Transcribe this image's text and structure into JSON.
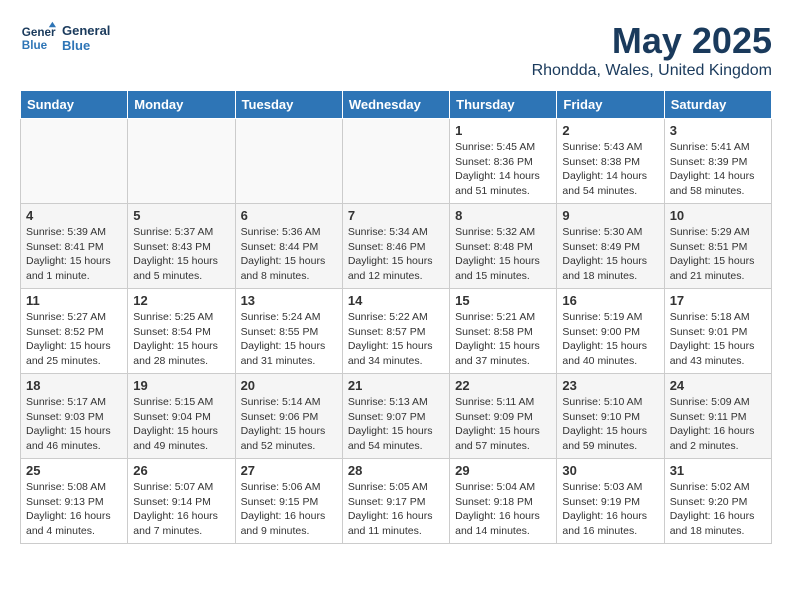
{
  "logo": {
    "line1": "General",
    "line2": "Blue"
  },
  "title": "May 2025",
  "location": "Rhondda, Wales, United Kingdom",
  "weekdays": [
    "Sunday",
    "Monday",
    "Tuesday",
    "Wednesday",
    "Thursday",
    "Friday",
    "Saturday"
  ],
  "weeks": [
    [
      {
        "day": "",
        "info": ""
      },
      {
        "day": "",
        "info": ""
      },
      {
        "day": "",
        "info": ""
      },
      {
        "day": "",
        "info": ""
      },
      {
        "day": "1",
        "info": "Sunrise: 5:45 AM\nSunset: 8:36 PM\nDaylight: 14 hours\nand 51 minutes."
      },
      {
        "day": "2",
        "info": "Sunrise: 5:43 AM\nSunset: 8:38 PM\nDaylight: 14 hours\nand 54 minutes."
      },
      {
        "day": "3",
        "info": "Sunrise: 5:41 AM\nSunset: 8:39 PM\nDaylight: 14 hours\nand 58 minutes."
      }
    ],
    [
      {
        "day": "4",
        "info": "Sunrise: 5:39 AM\nSunset: 8:41 PM\nDaylight: 15 hours\nand 1 minute."
      },
      {
        "day": "5",
        "info": "Sunrise: 5:37 AM\nSunset: 8:43 PM\nDaylight: 15 hours\nand 5 minutes."
      },
      {
        "day": "6",
        "info": "Sunrise: 5:36 AM\nSunset: 8:44 PM\nDaylight: 15 hours\nand 8 minutes."
      },
      {
        "day": "7",
        "info": "Sunrise: 5:34 AM\nSunset: 8:46 PM\nDaylight: 15 hours\nand 12 minutes."
      },
      {
        "day": "8",
        "info": "Sunrise: 5:32 AM\nSunset: 8:48 PM\nDaylight: 15 hours\nand 15 minutes."
      },
      {
        "day": "9",
        "info": "Sunrise: 5:30 AM\nSunset: 8:49 PM\nDaylight: 15 hours\nand 18 minutes."
      },
      {
        "day": "10",
        "info": "Sunrise: 5:29 AM\nSunset: 8:51 PM\nDaylight: 15 hours\nand 21 minutes."
      }
    ],
    [
      {
        "day": "11",
        "info": "Sunrise: 5:27 AM\nSunset: 8:52 PM\nDaylight: 15 hours\nand 25 minutes."
      },
      {
        "day": "12",
        "info": "Sunrise: 5:25 AM\nSunset: 8:54 PM\nDaylight: 15 hours\nand 28 minutes."
      },
      {
        "day": "13",
        "info": "Sunrise: 5:24 AM\nSunset: 8:55 PM\nDaylight: 15 hours\nand 31 minutes."
      },
      {
        "day": "14",
        "info": "Sunrise: 5:22 AM\nSunset: 8:57 PM\nDaylight: 15 hours\nand 34 minutes."
      },
      {
        "day": "15",
        "info": "Sunrise: 5:21 AM\nSunset: 8:58 PM\nDaylight: 15 hours\nand 37 minutes."
      },
      {
        "day": "16",
        "info": "Sunrise: 5:19 AM\nSunset: 9:00 PM\nDaylight: 15 hours\nand 40 minutes."
      },
      {
        "day": "17",
        "info": "Sunrise: 5:18 AM\nSunset: 9:01 PM\nDaylight: 15 hours\nand 43 minutes."
      }
    ],
    [
      {
        "day": "18",
        "info": "Sunrise: 5:17 AM\nSunset: 9:03 PM\nDaylight: 15 hours\nand 46 minutes."
      },
      {
        "day": "19",
        "info": "Sunrise: 5:15 AM\nSunset: 9:04 PM\nDaylight: 15 hours\nand 49 minutes."
      },
      {
        "day": "20",
        "info": "Sunrise: 5:14 AM\nSunset: 9:06 PM\nDaylight: 15 hours\nand 52 minutes."
      },
      {
        "day": "21",
        "info": "Sunrise: 5:13 AM\nSunset: 9:07 PM\nDaylight: 15 hours\nand 54 minutes."
      },
      {
        "day": "22",
        "info": "Sunrise: 5:11 AM\nSunset: 9:09 PM\nDaylight: 15 hours\nand 57 minutes."
      },
      {
        "day": "23",
        "info": "Sunrise: 5:10 AM\nSunset: 9:10 PM\nDaylight: 15 hours\nand 59 minutes."
      },
      {
        "day": "24",
        "info": "Sunrise: 5:09 AM\nSunset: 9:11 PM\nDaylight: 16 hours\nand 2 minutes."
      }
    ],
    [
      {
        "day": "25",
        "info": "Sunrise: 5:08 AM\nSunset: 9:13 PM\nDaylight: 16 hours\nand 4 minutes."
      },
      {
        "day": "26",
        "info": "Sunrise: 5:07 AM\nSunset: 9:14 PM\nDaylight: 16 hours\nand 7 minutes."
      },
      {
        "day": "27",
        "info": "Sunrise: 5:06 AM\nSunset: 9:15 PM\nDaylight: 16 hours\nand 9 minutes."
      },
      {
        "day": "28",
        "info": "Sunrise: 5:05 AM\nSunset: 9:17 PM\nDaylight: 16 hours\nand 11 minutes."
      },
      {
        "day": "29",
        "info": "Sunrise: 5:04 AM\nSunset: 9:18 PM\nDaylight: 16 hours\nand 14 minutes."
      },
      {
        "day": "30",
        "info": "Sunrise: 5:03 AM\nSunset: 9:19 PM\nDaylight: 16 hours\nand 16 minutes."
      },
      {
        "day": "31",
        "info": "Sunrise: 5:02 AM\nSunset: 9:20 PM\nDaylight: 16 hours\nand 18 minutes."
      }
    ]
  ]
}
